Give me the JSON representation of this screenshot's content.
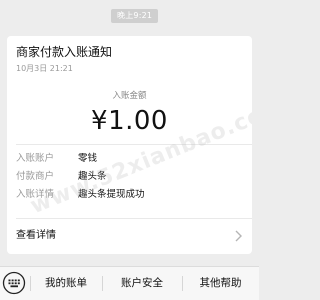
{
  "chat": {
    "timestamp": "晚上9:21"
  },
  "card": {
    "title": "商家付款入账通知",
    "date": "10月3日 21:21",
    "amount_label": "入账金额",
    "amount": "¥1.00",
    "details": [
      {
        "label": "入账账户",
        "value": "零钱"
      },
      {
        "label": "付款商户",
        "value": "趣头条"
      },
      {
        "label": "入账详情",
        "value": "趣头条提现成功"
      }
    ],
    "view_details": "查看详情",
    "watermark": "www.52xianbao.com"
  },
  "bottom_menu": {
    "keyboard_icon": "keyboard-icon",
    "items": [
      "我的账单",
      "账户安全",
      "其他帮助"
    ]
  }
}
